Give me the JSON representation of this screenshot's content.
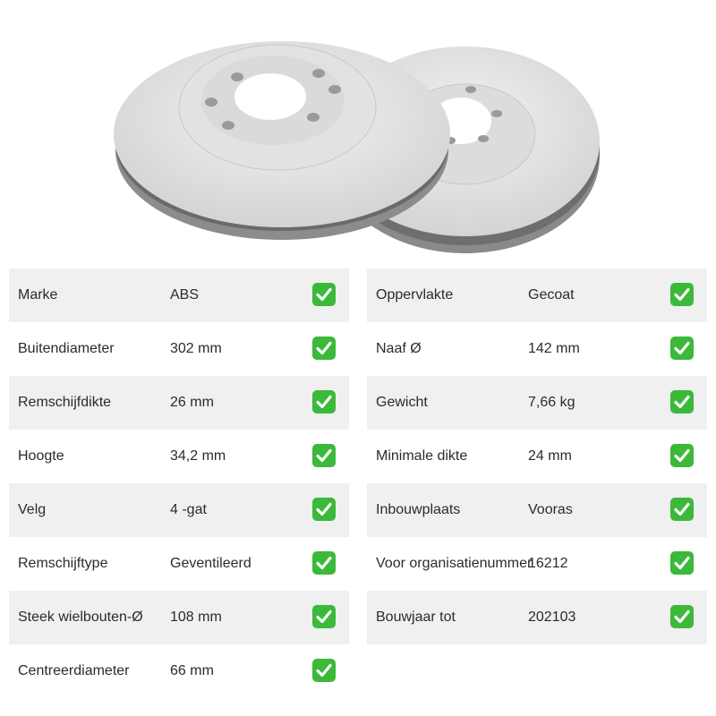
{
  "specs_left": [
    {
      "label": "Marke",
      "value": "ABS",
      "icon": "check-icon"
    },
    {
      "label": "Buitendiameter",
      "value": "302 mm",
      "icon": "check-icon"
    },
    {
      "label": "Remschijfdikte",
      "value": "26 mm",
      "icon": "check-icon"
    },
    {
      "label": "Hoogte",
      "value": "34,2 mm",
      "icon": "check-icon"
    },
    {
      "label": "Velg",
      "value": "4 -gat",
      "icon": "check-icon"
    },
    {
      "label": "Remschijftype",
      "value": "Geventileerd",
      "icon": "check-icon"
    },
    {
      "label": "Steek wielbouten-Ø",
      "value": "108 mm",
      "icon": "check-icon"
    },
    {
      "label": "Centreerdiameter",
      "value": "66 mm",
      "icon": "check-icon"
    }
  ],
  "specs_right": [
    {
      "label": "Oppervlakte",
      "value": "Gecoat",
      "icon": "check-icon"
    },
    {
      "label": "Naaf Ø",
      "value": "142 mm",
      "icon": "check-icon"
    },
    {
      "label": "Gewicht",
      "value": "7,66 kg",
      "icon": "check-icon"
    },
    {
      "label": "Minimale dikte",
      "value": "24 mm",
      "icon": "check-icon"
    },
    {
      "label": "Inbouwplaats",
      "value": "Vooras",
      "icon": "check-icon"
    },
    {
      "label": "Voor organisatienummer",
      "value": "16212",
      "icon": "check-icon"
    },
    {
      "label": "Bouwjaar tot",
      "value": "202103",
      "icon": "check-icon"
    }
  ],
  "colors": {
    "row_shade": "#f0f0f0",
    "check_green": "#3bb93b"
  }
}
